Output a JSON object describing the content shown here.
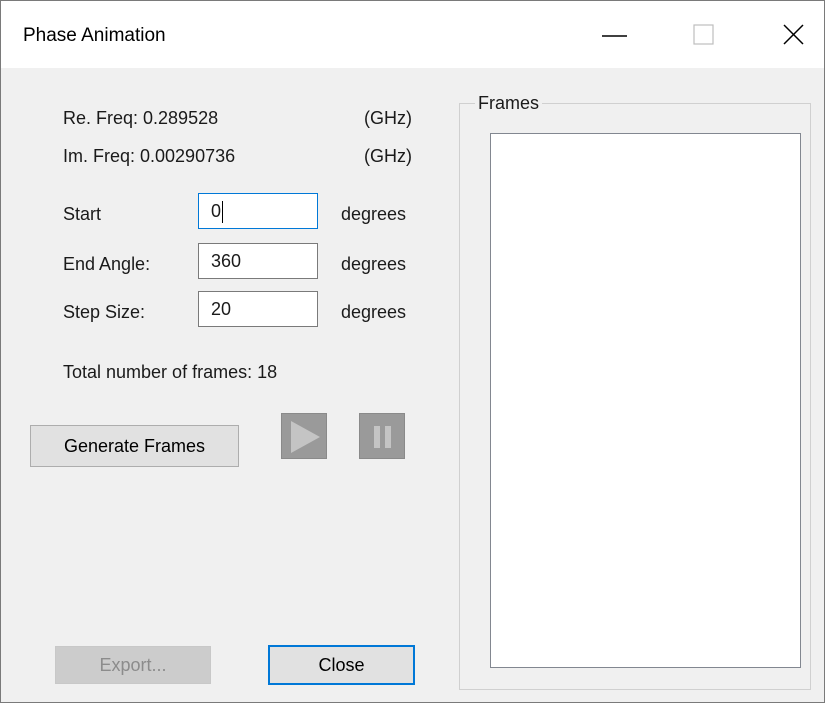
{
  "window": {
    "title": "Phase Animation",
    "controls": {
      "minimize_icon": "minimize-icon",
      "maximize_icon": "maximize-icon",
      "close_icon": "close-icon"
    }
  },
  "freq": {
    "re_label": "Re. Freq: 0.289528",
    "re_unit": "(GHz)",
    "im_label": "Im. Freq: 0.00290736",
    "im_unit": "(GHz)"
  },
  "fields": {
    "start": {
      "label": "Start",
      "value": "0",
      "unit": "degrees"
    },
    "end": {
      "label": "End Angle:",
      "value": "360",
      "unit": "degrees"
    },
    "step": {
      "label": "Step Size:",
      "value": "20",
      "unit": "degrees"
    }
  },
  "total_frames": "Total number of frames: 18",
  "buttons": {
    "generate": "Generate Frames",
    "play_icon": "play-icon",
    "pause_icon": "pause-icon",
    "export": "Export...",
    "close": "Close"
  },
  "frames_group": {
    "legend": "Frames"
  },
  "colors": {
    "accent": "#0078d7",
    "dialog_bg": "#f0f0f0",
    "disabled_media": "#9a9a9a"
  }
}
